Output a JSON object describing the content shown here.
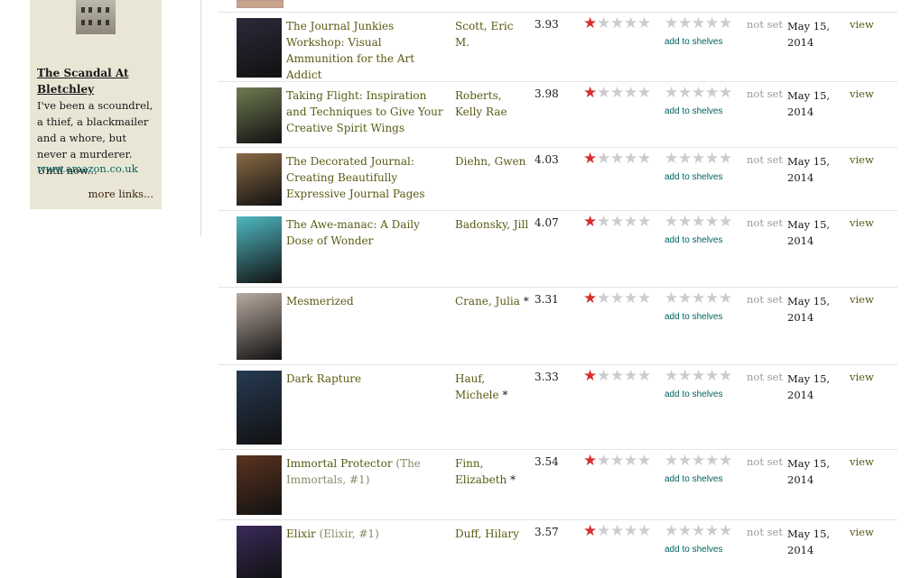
{
  "ad": {
    "title": "The Scandal At Bletchley",
    "body": "I've been a scoundrel, a thief, a blackmailer and a whore, but never a murderer. Until now...",
    "link": "www.amazon.co.uk",
    "more": "more links..."
  },
  "rating_empty_star": "☆",
  "common": {
    "add_to_shelves": "add to shelves",
    "not_set": "not set",
    "view": "view"
  },
  "rows": [
    {
      "title": "The Journal Junkies Workshop: Visual Ammunition for the Art Addict",
      "series": "",
      "author": "Scott, Eric M.",
      "author_mark": "",
      "avg": "3.93",
      "date": "May 15, 2014",
      "cover": "#2b2a3a"
    },
    {
      "title": "Taking Flight: Inspiration and Techniques to Give Your Creative Spirit Wings",
      "series": "",
      "author": "Roberts, Kelly Rae",
      "author_mark": "",
      "avg": "3.98",
      "date": "May 15, 2014",
      "cover": "#6f7a52"
    },
    {
      "title": "The Decorated Journal: Creating Beautifully Expressive Journal Pages",
      "series": "",
      "author": "Diehn, Gwen",
      "author_mark": "",
      "avg": "4.03",
      "date": "May 15, 2014",
      "cover": "#8a6a45"
    },
    {
      "title": "The Awe-manac: A Daily Dose of Wonder",
      "series": "",
      "author": "Badonsky, Jill",
      "author_mark": "",
      "avg": "4.07",
      "date": "May 15, 2014",
      "cover": "#4fb9c2"
    },
    {
      "title": "Mesmerized",
      "series": "",
      "author": "Crane, Julia",
      "author_mark": "*",
      "avg": "3.31",
      "date": "May 15, 2014",
      "cover": "#b9aaa0"
    },
    {
      "title": "Dark Rapture",
      "series": "",
      "author": "Hauf, Michele",
      "author_mark": "*",
      "avg": "3.33",
      "date": "May 15, 2014",
      "cover": "#263a52"
    },
    {
      "title": "Immortal Protector",
      "series": "(The Immortals, #1)",
      "author": "Finn, Elizabeth",
      "author_mark": "*",
      "avg": "3.54",
      "date": "May 15, 2014",
      "cover": "#5a3420"
    },
    {
      "title": "Elixir",
      "series": "(Elixir, #1)",
      "author": "Duff, Hilary",
      "author_mark": "",
      "avg": "3.57",
      "date": "May 15, 2014",
      "cover": "#3a2a5a"
    }
  ],
  "icons": {
    "filled_star": "★",
    "empty_star": "★"
  }
}
